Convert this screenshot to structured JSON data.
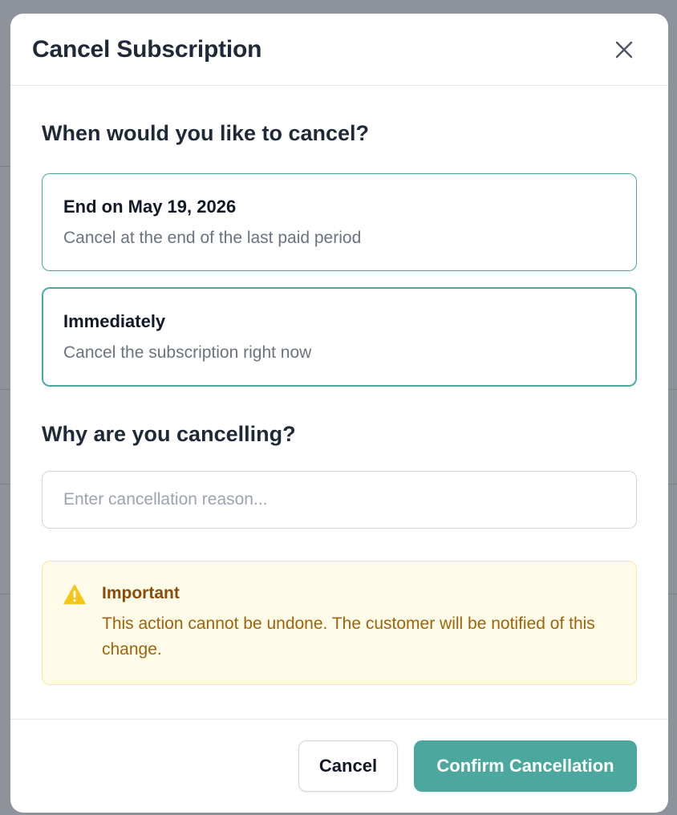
{
  "modal": {
    "title": "Cancel Subscription",
    "close_icon": "close-icon"
  },
  "when_section": {
    "title": "When would you like to cancel?",
    "options": [
      {
        "title": "End on May 19, 2026",
        "description": "Cancel at the end of the last paid period",
        "selected": false
      },
      {
        "title": "Immediately",
        "description": "Cancel the subscription right now",
        "selected": true
      }
    ]
  },
  "why_section": {
    "title": "Why are you cancelling?",
    "reason_placeholder": "Enter cancellation reason...",
    "reason_value": ""
  },
  "warning": {
    "icon": "warning-icon",
    "title": "Important",
    "text": "This action cannot be undone. The customer will be notified of this change."
  },
  "footer": {
    "cancel_label": "Cancel",
    "confirm_label": "Confirm Cancellation"
  },
  "colors": {
    "accent": "#4ca89e",
    "warning_bg": "#fefbe8",
    "warning_text": "#a0630b"
  }
}
